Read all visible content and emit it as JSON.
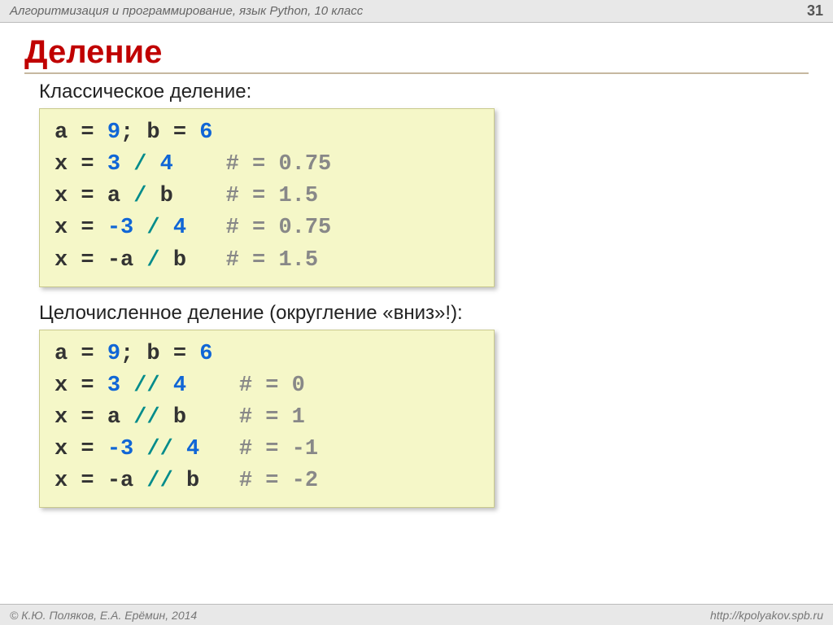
{
  "header": {
    "course": "Алгоритмизация и программирование, язык Python, 10 класс",
    "page_number": "31"
  },
  "title": "Деление",
  "section1": {
    "heading": "Классическое деление:",
    "lines": [
      {
        "prefix": "a",
        "eq": " = ",
        "n1": "9",
        "sep": "; ",
        "v2": "b",
        "eq2": " = ",
        "n2": "6"
      },
      {
        "prefix": "x",
        "eq": " = ",
        "n1": "3",
        "op": " / ",
        "n2": "4",
        "pad": "    ",
        "cmt": "# = 0.75"
      },
      {
        "prefix": "x",
        "eq": " = ",
        "v1": "a",
        "op": " / ",
        "v2": "b",
        "pad": "    ",
        "cmt": "# = 1.5"
      },
      {
        "prefix": "x",
        "eq": " = ",
        "n1": "-3",
        "op": " / ",
        "n2": "4",
        "pad": "   ",
        "cmt": "# = 0.75"
      },
      {
        "prefix": "x",
        "eq": " = ",
        "v1": "-a",
        "op": " / ",
        "v2": "b",
        "pad": "   ",
        "cmt": "# = 1.5"
      }
    ]
  },
  "section2": {
    "heading": "Целочисленное деление (округление «вниз»!):",
    "lines": [
      {
        "prefix": "a",
        "eq": " = ",
        "n1": "9",
        "sep": "; ",
        "v2": "b",
        "eq2": " = ",
        "n2": "6"
      },
      {
        "prefix": "x",
        "eq": " = ",
        "n1": "3",
        "op": " // ",
        "n2": "4",
        "pad": "    ",
        "cmt": "# = 0"
      },
      {
        "prefix": "x",
        "eq": " = ",
        "v1": "a",
        "op": " // ",
        "v2": "b",
        "pad": "    ",
        "cmt": "# = 1"
      },
      {
        "prefix": "x",
        "eq": " = ",
        "n1": "-3",
        "op": " // ",
        "n2": "4",
        "pad": "   ",
        "cmt": "# = -1"
      },
      {
        "prefix": "x",
        "eq": " = ",
        "v1": "-a",
        "op": " // ",
        "v2": "b",
        "pad": "   ",
        "cmt": "# = -2"
      }
    ]
  },
  "footer": {
    "copyright": "© К.Ю. Поляков, Е.А. Ерёмин, 2014",
    "url": "http://kpolyakov.spb.ru"
  }
}
